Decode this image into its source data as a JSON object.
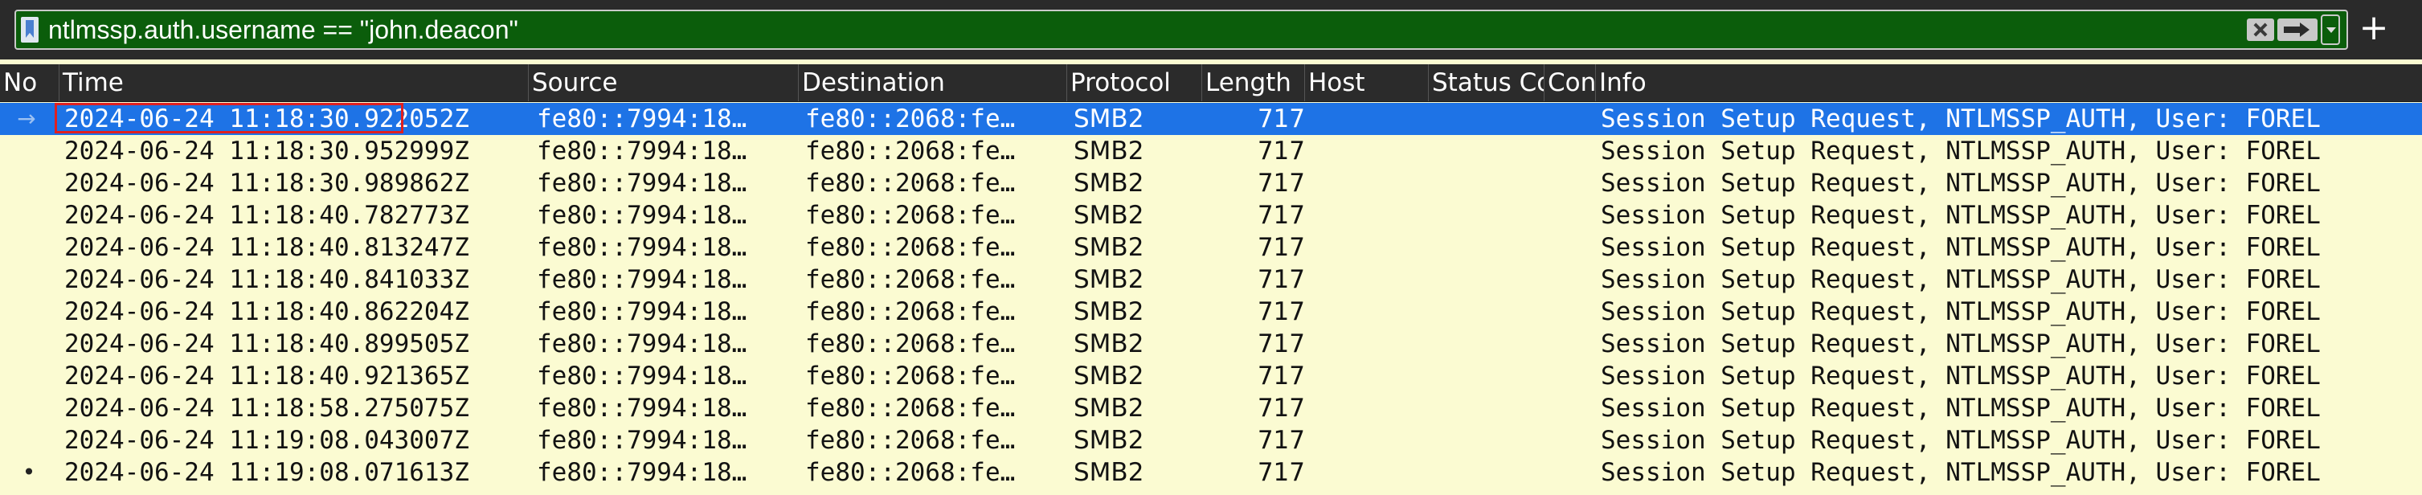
{
  "filter": {
    "value": "ntlmssp.auth.username == \"john.deacon\"",
    "add_label": "+"
  },
  "columns": [
    {
      "key": "no",
      "label": "No"
    },
    {
      "key": "time",
      "label": "Time"
    },
    {
      "key": "source",
      "label": "Source"
    },
    {
      "key": "destination",
      "label": "Destination"
    },
    {
      "key": "protocol",
      "label": "Protocol"
    },
    {
      "key": "length",
      "label": "Length"
    },
    {
      "key": "host",
      "label": "Host"
    },
    {
      "key": "status",
      "label": "Status Co"
    },
    {
      "key": "con",
      "label": "Con"
    },
    {
      "key": "info",
      "label": "Info"
    }
  ],
  "rows": [
    {
      "time": "2024-06-24 11:18:30.922052Z",
      "source": "fe80::7994:18…",
      "destination": "fe80::2068:fe…",
      "protocol": "SMB2",
      "length": "717",
      "info": "Session Setup Request, NTLMSSP_AUTH, User: FOREL",
      "selected": true,
      "marker": "→"
    },
    {
      "time": "2024-06-24 11:18:30.952999Z",
      "source": "fe80::7994:18…",
      "destination": "fe80::2068:fe…",
      "protocol": "SMB2",
      "length": "717",
      "info": "Session Setup Request, NTLMSSP_AUTH, User: FOREL",
      "selected": false,
      "marker": ""
    },
    {
      "time": "2024-06-24 11:18:30.989862Z",
      "source": "fe80::7994:18…",
      "destination": "fe80::2068:fe…",
      "protocol": "SMB2",
      "length": "717",
      "info": "Session Setup Request, NTLMSSP_AUTH, User: FOREL",
      "selected": false,
      "marker": ""
    },
    {
      "time": "2024-06-24 11:18:40.782773Z",
      "source": "fe80::7994:18…",
      "destination": "fe80::2068:fe…",
      "protocol": "SMB2",
      "length": "717",
      "info": "Session Setup Request, NTLMSSP_AUTH, User: FOREL",
      "selected": false,
      "marker": ""
    },
    {
      "time": "2024-06-24 11:18:40.813247Z",
      "source": "fe80::7994:18…",
      "destination": "fe80::2068:fe…",
      "protocol": "SMB2",
      "length": "717",
      "info": "Session Setup Request, NTLMSSP_AUTH, User: FOREL",
      "selected": false,
      "marker": ""
    },
    {
      "time": "2024-06-24 11:18:40.841033Z",
      "source": "fe80::7994:18…",
      "destination": "fe80::2068:fe…",
      "protocol": "SMB2",
      "length": "717",
      "info": "Session Setup Request, NTLMSSP_AUTH, User: FOREL",
      "selected": false,
      "marker": ""
    },
    {
      "time": "2024-06-24 11:18:40.862204Z",
      "source": "fe80::7994:18…",
      "destination": "fe80::2068:fe…",
      "protocol": "SMB2",
      "length": "717",
      "info": "Session Setup Request, NTLMSSP_AUTH, User: FOREL",
      "selected": false,
      "marker": ""
    },
    {
      "time": "2024-06-24 11:18:40.899505Z",
      "source": "fe80::7994:18…",
      "destination": "fe80::2068:fe…",
      "protocol": "SMB2",
      "length": "717",
      "info": "Session Setup Request, NTLMSSP_AUTH, User: FOREL",
      "selected": false,
      "marker": ""
    },
    {
      "time": "2024-06-24 11:18:40.921365Z",
      "source": "fe80::7994:18…",
      "destination": "fe80::2068:fe…",
      "protocol": "SMB2",
      "length": "717",
      "info": "Session Setup Request, NTLMSSP_AUTH, User: FOREL",
      "selected": false,
      "marker": ""
    },
    {
      "time": "2024-06-24 11:18:58.275075Z",
      "source": "fe80::7994:18…",
      "destination": "fe80::2068:fe…",
      "protocol": "SMB2",
      "length": "717",
      "info": "Session Setup Request, NTLMSSP_AUTH, User: FOREL",
      "selected": false,
      "marker": ""
    },
    {
      "time": "2024-06-24 11:19:08.043007Z",
      "source": "fe80::7994:18…",
      "destination": "fe80::2068:fe…",
      "protocol": "SMB2",
      "length": "717",
      "info": "Session Setup Request, NTLMSSP_AUTH, User: FOREL",
      "selected": false,
      "marker": ""
    },
    {
      "time": "2024-06-24 11:19:08.071613Z",
      "source": "fe80::7994:18…",
      "destination": "fe80::2068:fe…",
      "protocol": "SMB2",
      "length": "717",
      "info": "Session Setup Request, NTLMSSP_AUTH, User: FOREL",
      "selected": false,
      "marker": "•"
    }
  ],
  "colors": {
    "filter_bg": "#0b5d0b",
    "row_bg": "#fbfbd2",
    "selected_bg": "#1e73e6",
    "highlight_border": "#e02020"
  },
  "icons": {
    "bookmark": "bookmark-icon",
    "clear": "clear-icon",
    "apply": "apply-arrow-icon",
    "dropdown": "chevron-down-icon",
    "add": "plus-icon"
  }
}
